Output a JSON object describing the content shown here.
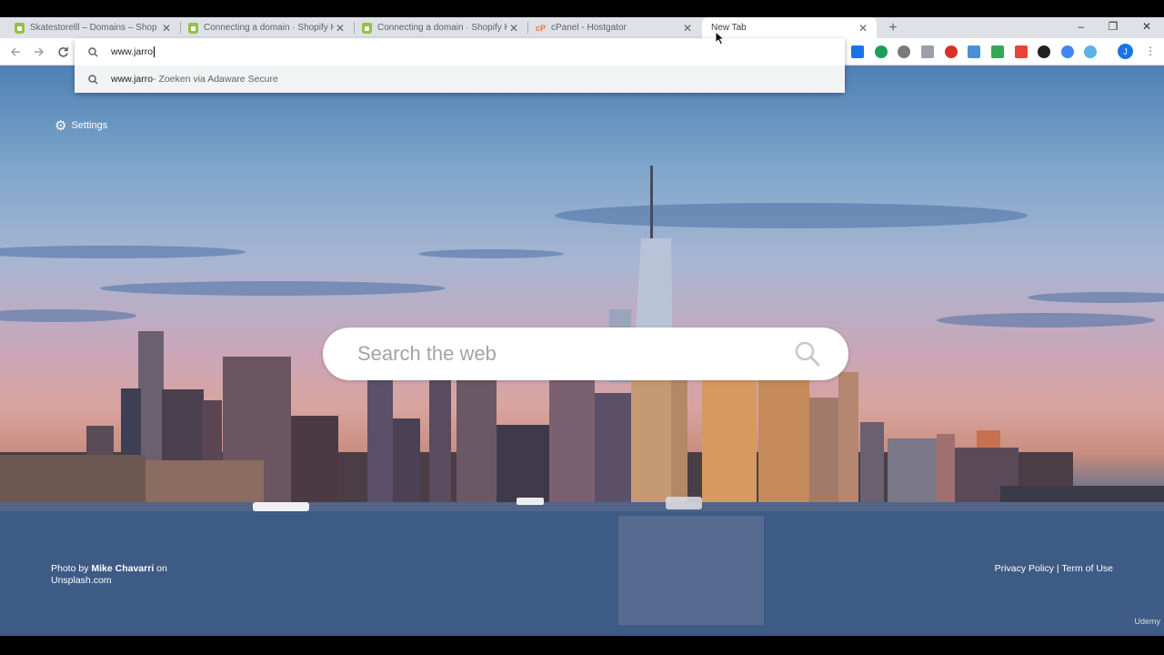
{
  "tabs": [
    {
      "title": "Skatestorelll – Domains – Shop",
      "favicon": "shopify-icon",
      "active": false
    },
    {
      "title": "Connecting a domain · Shopify H",
      "favicon": "shopify-icon",
      "active": false
    },
    {
      "title": "Connecting a domain · Shopify H",
      "favicon": "shopify-icon",
      "active": false
    },
    {
      "title": "cPanel - Hostgator",
      "favicon": "cpanel-icon",
      "active": false
    },
    {
      "title": "New Tab",
      "favicon": "",
      "active": true
    }
  ],
  "tab_close_glyph": "✕",
  "new_tab_glyph": "+",
  "window_controls": {
    "minimize": "–",
    "maximize": "❐",
    "close": "✕"
  },
  "omnibox": {
    "typed_text": "www.jarro",
    "suggestion_query": "www.jarro",
    "suggestion_suffix": " - Zoeken via Adaware Secure"
  },
  "settings_label": "Settings",
  "search": {
    "placeholder": "Search the web"
  },
  "photo_credit": {
    "prefix": "Photo by ",
    "author": "Mike Chavarri",
    "on": " on",
    "site": "Unsplash.com"
  },
  "legal": {
    "privacy": "Privacy Policy",
    "separator": " | ",
    "terms": "Term of Use"
  },
  "watermark": "Udemy",
  "profile_initial": "J",
  "colors": {
    "tab_strip": "#dee1e6",
    "shopify_green": "#95bf47",
    "cpanel_orange": "#ff6c2c",
    "profile": "#1a73e8"
  }
}
